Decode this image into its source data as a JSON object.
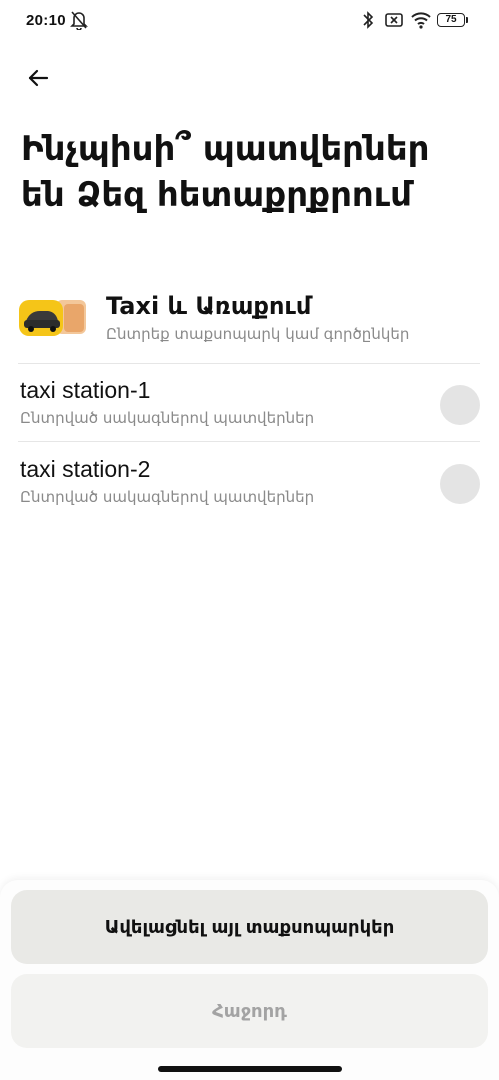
{
  "status_bar": {
    "time": "20:10",
    "battery": "75",
    "icons": [
      "mute-bell-icon",
      "bluetooth-icon",
      "no-sim-icon",
      "wifi-icon",
      "battery-icon"
    ]
  },
  "header": {
    "back_icon": "arrow-left-icon",
    "title": "Ինչպիսի՞ պատվերներ են Ձեզ հետաքրքրում"
  },
  "provider": {
    "name": "Taxi և Առաքում",
    "subtitle": "Ընտրեք տաքսոպարկ կամ գործընկեր"
  },
  "stations": [
    {
      "title": "taxi station-1",
      "subtitle": "Ընտրված սակագներով պատվերներ",
      "selected": false
    },
    {
      "title": "taxi station-2",
      "subtitle": "Ընտրված սակագներով պատվերներ",
      "selected": false
    }
  ],
  "buttons": {
    "add_label": "Ավելացնել այլ տաքսոպարկեր",
    "next_label": "Հաջորդ"
  },
  "colors": {
    "background": "#ffffff",
    "button_primary": "#e9e9e6",
    "button_disabled": "#f2f2f0",
    "radio": "#e4e4e4",
    "logo_yellow": "#f5c518"
  }
}
